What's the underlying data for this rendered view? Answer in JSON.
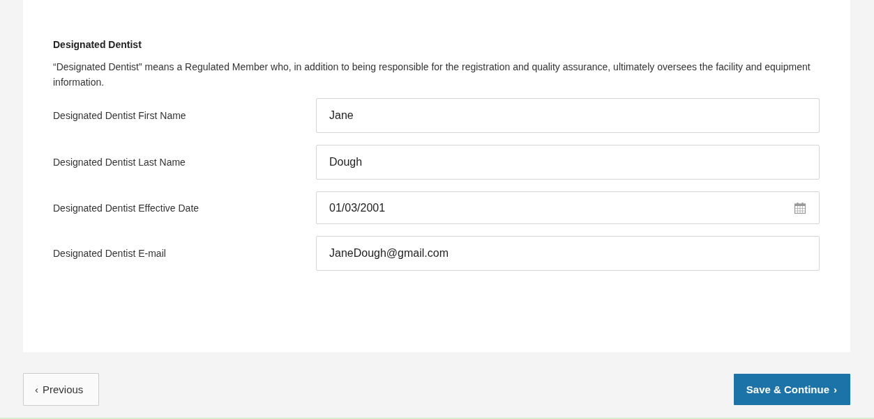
{
  "section": {
    "title": "Designated Dentist",
    "description": "“Designated Dentist” means a Regulated Member who, in addition to being responsible for the registration and quality assurance, ultimately oversees the facility and equipment information."
  },
  "fields": [
    {
      "kind": "text",
      "label": "Designated Dentist First Name",
      "value": "Jane"
    },
    {
      "kind": "text",
      "label": "Designated Dentist Last Name",
      "value": "Dough"
    },
    {
      "kind": "date",
      "label": "Designated Dentist Effective Date",
      "value": "01/03/2001"
    },
    {
      "kind": "text",
      "label": "Designated Dentist E-mail",
      "value": "JaneDough@gmail.com"
    }
  ],
  "buttons": [
    {
      "kind": "secondary",
      "label": "Previous",
      "icon": "‹"
    },
    {
      "kind": "primary",
      "label": "Save & Continue",
      "icon": "›"
    }
  ]
}
